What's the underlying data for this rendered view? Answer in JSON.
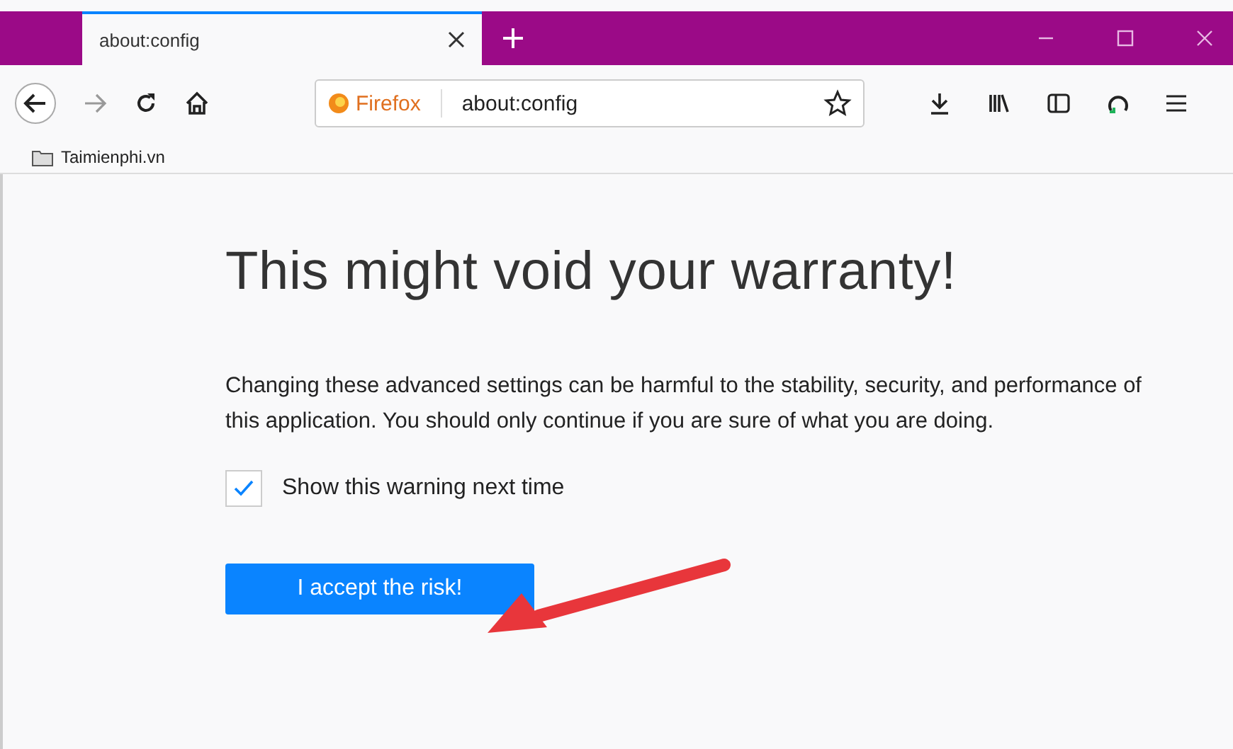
{
  "tabs": [
    {
      "label": "about:config",
      "selected": true
    }
  ],
  "address_bar": {
    "identity": "Firefox",
    "value": "about:config"
  },
  "bookmarks": [
    {
      "label": "Taimienphi.vn"
    }
  ],
  "page": {
    "heading": "This might void your warranty!",
    "message": "Changing these advanced settings can be harmful to the stability, security, and performance of this application. You should only continue if you are sure of what you are doing.",
    "checkbox": {
      "label": "Show this warning next time",
      "checked": true
    },
    "button": "I accept the risk!"
  }
}
